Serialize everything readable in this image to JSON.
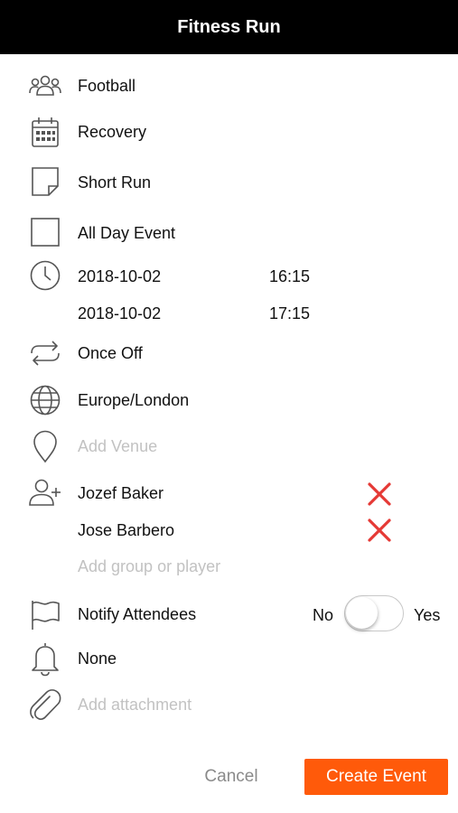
{
  "header": {
    "title": "Fitness Run"
  },
  "team": {
    "icon": "group-icon",
    "value": "Football"
  },
  "category": {
    "icon": "calendar-icon",
    "value": "Recovery"
  },
  "title_field": {
    "icon": "note-icon",
    "value": "Short Run"
  },
  "all_day": {
    "icon": "checkbox-icon",
    "label": "All Day Event",
    "checked": false
  },
  "schedule": {
    "icon": "clock-icon",
    "start_date": "2018-10-02",
    "start_time": "16:15",
    "end_date": "2018-10-02",
    "end_time": "17:15"
  },
  "repeat": {
    "icon": "repeat-icon",
    "value": "Once Off"
  },
  "timezone": {
    "icon": "globe-icon",
    "value": "Europe/London"
  },
  "venue": {
    "icon": "location-pin-icon",
    "placeholder": "Add Venue"
  },
  "attendees": {
    "icon": "add-person-icon",
    "list": [
      {
        "name": "Jozef Baker",
        "remove_icon": "remove-x-icon"
      },
      {
        "name": "Jose Barbero",
        "remove_icon": "remove-x-icon"
      }
    ],
    "add_placeholder": "Add group or player"
  },
  "notify": {
    "icon": "flag-icon",
    "label": "Notify Attendees",
    "no_label": "No",
    "yes_label": "Yes",
    "value": "No"
  },
  "reminder": {
    "icon": "bell-icon",
    "value": "None"
  },
  "attachment": {
    "icon": "paperclip-icon",
    "placeholder": "Add attachment"
  },
  "actions": {
    "cancel_label": "Cancel",
    "create_label": "Create Event"
  },
  "colors": {
    "header_bg": "#000000",
    "accent": "#ff5a0a",
    "remove": "#e53935",
    "placeholder": "#c2c2c2"
  }
}
